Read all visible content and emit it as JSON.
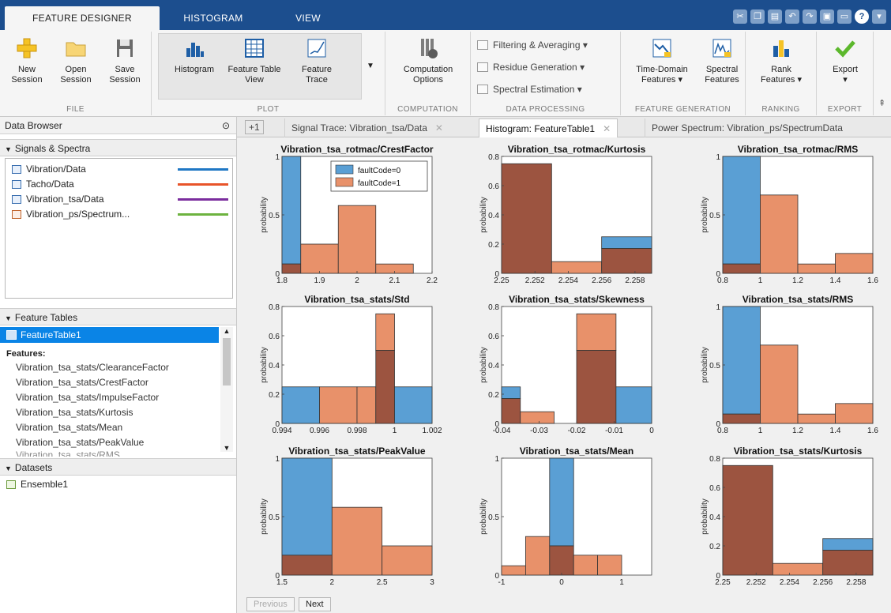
{
  "tabs": [
    {
      "label": "FEATURE DESIGNER",
      "active": true
    },
    {
      "label": "HISTOGRAM",
      "active": false
    },
    {
      "label": "VIEW",
      "active": false
    }
  ],
  "help_glyph": "?",
  "ribbon": {
    "file": {
      "caption": "FILE",
      "buttons": [
        {
          "label": "New Session",
          "icon": "new-icon"
        },
        {
          "label": "Open Session",
          "icon": "folder-icon"
        },
        {
          "label": "Save Session",
          "icon": "save-icon"
        }
      ]
    },
    "plot": {
      "caption": "PLOT",
      "buttons": [
        {
          "label": "Histogram",
          "icon": "histogram-icon"
        },
        {
          "label": "Feature Table View",
          "icon": "table-icon"
        },
        {
          "label": "Feature Trace",
          "icon": "trace-icon"
        }
      ]
    },
    "computation": {
      "caption": "COMPUTATION",
      "button": "Computation Options"
    },
    "data_processing": {
      "caption": "DATA PROCESSING",
      "items": [
        "Filtering & Averaging ▾",
        "Residue Generation ▾",
        "Spectral Estimation ▾"
      ]
    },
    "feature_generation": {
      "caption": "FEATURE GENERATION",
      "buttons": [
        "Time-Domain Features ▾",
        "Spectral Features"
      ]
    },
    "ranking": {
      "caption": "RANKING",
      "button": "Rank Features ▾"
    },
    "export": {
      "caption": "EXPORT",
      "button": "Export"
    }
  },
  "data_browser": {
    "title": "Data Browser"
  },
  "signals": {
    "title": "Signals & Spectra",
    "items": [
      {
        "name": "Vibration/Data",
        "color": "#1f77c4"
      },
      {
        "name": "Tacho/Data",
        "color": "#e8542a"
      },
      {
        "name": "Vibration_tsa/Data",
        "color": "#7b2d9e"
      },
      {
        "name": "Vibration_ps/Spectrum...",
        "color": "#6db33f"
      }
    ]
  },
  "feature_tables": {
    "title": "Feature Tables",
    "selected": "FeatureTable1",
    "features_label": "Features:",
    "features": [
      "Vibration_tsa_stats/ClearanceFactor",
      "Vibration_tsa_stats/CrestFactor",
      "Vibration_tsa_stats/ImpulseFactor",
      "Vibration_tsa_stats/Kurtosis",
      "Vibration_tsa_stats/Mean",
      "Vibration_tsa_stats/PeakValue",
      "Vibration_tsa_stats/RMS"
    ]
  },
  "datasets": {
    "title": "Datasets",
    "items": [
      "Ensemble1"
    ]
  },
  "doc_tabs": [
    "Signal Trace: Vibration_tsa/Data",
    "Histogram: FeatureTable1",
    "Power Spectrum: Vibration_ps/SpectrumData"
  ],
  "doc_tab_plus": "+1",
  "nav": {
    "previous": "Previous",
    "next": "Next"
  },
  "colors": {
    "fault0": "#5a9fd4",
    "fault1": "#e8916a",
    "overlap": "#9c5440",
    "tab_bar": "#1c4e8e",
    "selection": "#0a84e6"
  },
  "chart_data": [
    {
      "type": "bar",
      "title": "Vibration_tsa_rotmac/CrestFactor",
      "ylabel": "probability",
      "ylim": [
        0,
        1
      ],
      "xlim": [
        1.8,
        2.2
      ],
      "xticks": [
        "1.8",
        "1.9",
        "2",
        "2.1",
        "2.2"
      ],
      "yticks": [
        "0",
        "0.5",
        "1"
      ],
      "edges": [
        1.8,
        1.85,
        1.95,
        2.05,
        2.15,
        2.2
      ],
      "series": [
        {
          "name": "faultCode=0",
          "values": [
            1,
            0,
            0,
            0,
            0
          ]
        },
        {
          "name": "faultCode=1",
          "values": [
            0.08,
            0.25,
            0.58,
            0.08,
            0
          ]
        }
      ],
      "legend": "top-right"
    },
    {
      "type": "bar",
      "title": "Vibration_tsa_rotmac/Kurtosis",
      "ylabel": "probability",
      "ylim": [
        0,
        0.8
      ],
      "xlim": [
        2.25,
        2.259
      ],
      "xticks": [
        "2.25",
        "2.252",
        "2.254",
        "2.256",
        "2.258"
      ],
      "yticks": [
        "0",
        "0.2",
        "0.4",
        "0.6",
        "0.8"
      ],
      "edges": [
        2.25,
        2.253,
        2.256,
        2.259
      ],
      "series": [
        {
          "name": "faultCode=0",
          "values": [
            0.75,
            0,
            0.25
          ]
        },
        {
          "name": "faultCode=1",
          "values": [
            0.75,
            0.08,
            0.17
          ]
        }
      ]
    },
    {
      "type": "bar",
      "title": "Vibration_tsa_rotmac/RMS",
      "ylabel": "probability",
      "ylim": [
        0,
        1
      ],
      "xlim": [
        0.8,
        1.6
      ],
      "xticks": [
        "0.8",
        "1",
        "1.2",
        "1.4",
        "1.6"
      ],
      "yticks": [
        "0",
        "0.5",
        "1"
      ],
      "edges": [
        0.8,
        1,
        1.2,
        1.4,
        1.6
      ],
      "series": [
        {
          "name": "faultCode=0",
          "values": [
            1,
            0,
            0,
            0
          ]
        },
        {
          "name": "faultCode=1",
          "values": [
            0.08,
            0.67,
            0.08,
            0.17
          ]
        }
      ]
    },
    {
      "type": "bar",
      "title": "Vibration_tsa_stats/Std",
      "ylabel": "probability",
      "ylim": [
        0,
        0.8
      ],
      "xlim": [
        0.994,
        1.002
      ],
      "xticks": [
        "0.994",
        "0.996",
        "0.998",
        "1",
        "1.002"
      ],
      "yticks": [
        "0",
        "0.2",
        "0.4",
        "0.6",
        "0.8"
      ],
      "edges": [
        0.994,
        0.996,
        0.998,
        0.999,
        1,
        1.002
      ],
      "series": [
        {
          "name": "faultCode=0",
          "values": [
            0.25,
            0,
            0,
            0.5,
            0.25
          ]
        },
        {
          "name": "faultCode=1",
          "values": [
            0,
            0.25,
            0.25,
            0.75,
            0
          ]
        }
      ]
    },
    {
      "type": "bar",
      "title": "Vibration_tsa_stats/Skewness",
      "ylabel": "probability",
      "ylim": [
        0,
        0.8
      ],
      "xlim": [
        -0.04,
        0
      ],
      "xticks": [
        "-0.04",
        "-0.03",
        "-0.02",
        "-0.01",
        "0"
      ],
      "yticks": [
        "0",
        "0.2",
        "0.4",
        "0.6",
        "0.8"
      ],
      "edges": [
        -0.04,
        -0.035,
        -0.026,
        -0.02,
        -0.0095,
        0
      ],
      "series": [
        {
          "name": "faultCode=0",
          "values": [
            0.25,
            0,
            0,
            0.5,
            0.25
          ]
        },
        {
          "name": "faultCode=1",
          "values": [
            0.17,
            0.08,
            0,
            0.75,
            0
          ]
        }
      ]
    },
    {
      "type": "bar",
      "title": "Vibration_tsa_stats/RMS",
      "ylabel": "probability",
      "ylim": [
        0,
        1
      ],
      "xlim": [
        0.8,
        1.6
      ],
      "xticks": [
        "0.8",
        "1",
        "1.2",
        "1.4",
        "1.6"
      ],
      "yticks": [
        "0",
        "0.5",
        "1"
      ],
      "edges": [
        0.8,
        1,
        1.2,
        1.4,
        1.6
      ],
      "series": [
        {
          "name": "faultCode=0",
          "values": [
            1,
            0,
            0,
            0
          ]
        },
        {
          "name": "faultCode=1",
          "values": [
            0.08,
            0.67,
            0.08,
            0.17
          ]
        }
      ]
    },
    {
      "type": "bar",
      "title": "Vibration_tsa_stats/PeakValue",
      "ylabel": "probability",
      "ylim": [
        0,
        1
      ],
      "xlim": [
        1.5,
        3
      ],
      "xticks": [
        "1.5",
        "2",
        "2.5",
        "3"
      ],
      "yticks": [
        "0",
        "0.5",
        "1"
      ],
      "edges": [
        1.5,
        2,
        2.5,
        3
      ],
      "series": [
        {
          "name": "faultCode=0",
          "values": [
            1,
            0,
            0
          ]
        },
        {
          "name": "faultCode=1",
          "values": [
            0.17,
            0.58,
            0.25
          ]
        }
      ]
    },
    {
      "type": "bar",
      "title": "Vibration_tsa_stats/Mean",
      "ylabel": "probability",
      "ylim": [
        0,
        1
      ],
      "xlim": [
        -1,
        1.5
      ],
      "xticks": [
        "-1",
        "0",
        "1"
      ],
      "yticks": [
        "0",
        "0.5",
        "1"
      ],
      "edges": [
        -1,
        -0.6,
        -0.2,
        0.2,
        0.6,
        1,
        1.4
      ],
      "series": [
        {
          "name": "faultCode=0",
          "values": [
            0,
            0,
            1,
            0,
            0,
            0
          ]
        },
        {
          "name": "faultCode=1",
          "values": [
            0.08,
            0.33,
            0.25,
            0.17,
            0.17,
            0
          ]
        }
      ]
    },
    {
      "type": "bar",
      "title": "Vibration_tsa_stats/Kurtosis",
      "ylabel": "probability",
      "ylim": [
        0,
        0.8
      ],
      "xlim": [
        2.25,
        2.259
      ],
      "xticks": [
        "2.25",
        "2.252",
        "2.254",
        "2.256",
        "2.258"
      ],
      "yticks": [
        "0",
        "0.2",
        "0.4",
        "0.6",
        "0.8"
      ],
      "edges": [
        2.25,
        2.253,
        2.256,
        2.259
      ],
      "series": [
        {
          "name": "faultCode=0",
          "values": [
            0.75,
            0,
            0.25
          ]
        },
        {
          "name": "faultCode=1",
          "values": [
            0.75,
            0.08,
            0.17
          ]
        }
      ]
    }
  ]
}
